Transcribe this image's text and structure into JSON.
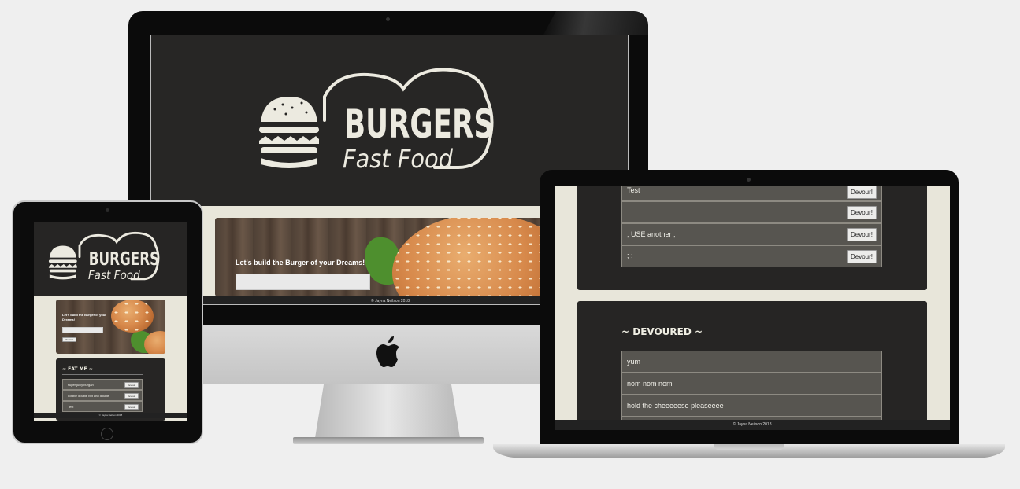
{
  "logo": {
    "name": "BURGERS",
    "tagline": "Fast Food"
  },
  "hero": {
    "title": "Let's build the Burger of your Dreams!",
    "input_value": "",
    "submit_label": "Submit"
  },
  "eat_me": {
    "heading": "~ EAT ME ~",
    "items": [
      {
        "name": "super juicy burgah",
        "button": "Devour!"
      },
      {
        "name": "double double bot and double",
        "button": "Devour!"
      },
      {
        "name": "Test",
        "button": "Devour!"
      }
    ],
    "laptop_items": [
      {
        "name": "Test",
        "button": "Devour!"
      },
      {
        "name": "",
        "button": "Devour!"
      },
      {
        "name": "; USE another ;",
        "button": "Devour!"
      },
      {
        "name": "; ;",
        "button": "Devour!"
      }
    ]
  },
  "devoured": {
    "heading": "~ DEVOURED ~",
    "items": [
      {
        "name": "yum"
      },
      {
        "name": "nom nom nom"
      },
      {
        "name": "hold the cheeeeese pleaseeee"
      }
    ]
  },
  "footer": {
    "text": "© Jayna Neilson 2018"
  },
  "colors": {
    "page_bg": "#efefef",
    "panel_bg": "#262524",
    "cream": "#e8e6da",
    "row_bg": "#575550",
    "logo_color": "#eceae0"
  },
  "icons": [
    "apple-logo-icon",
    "burger-icon",
    "webcam-icon",
    "home-button-icon"
  ]
}
